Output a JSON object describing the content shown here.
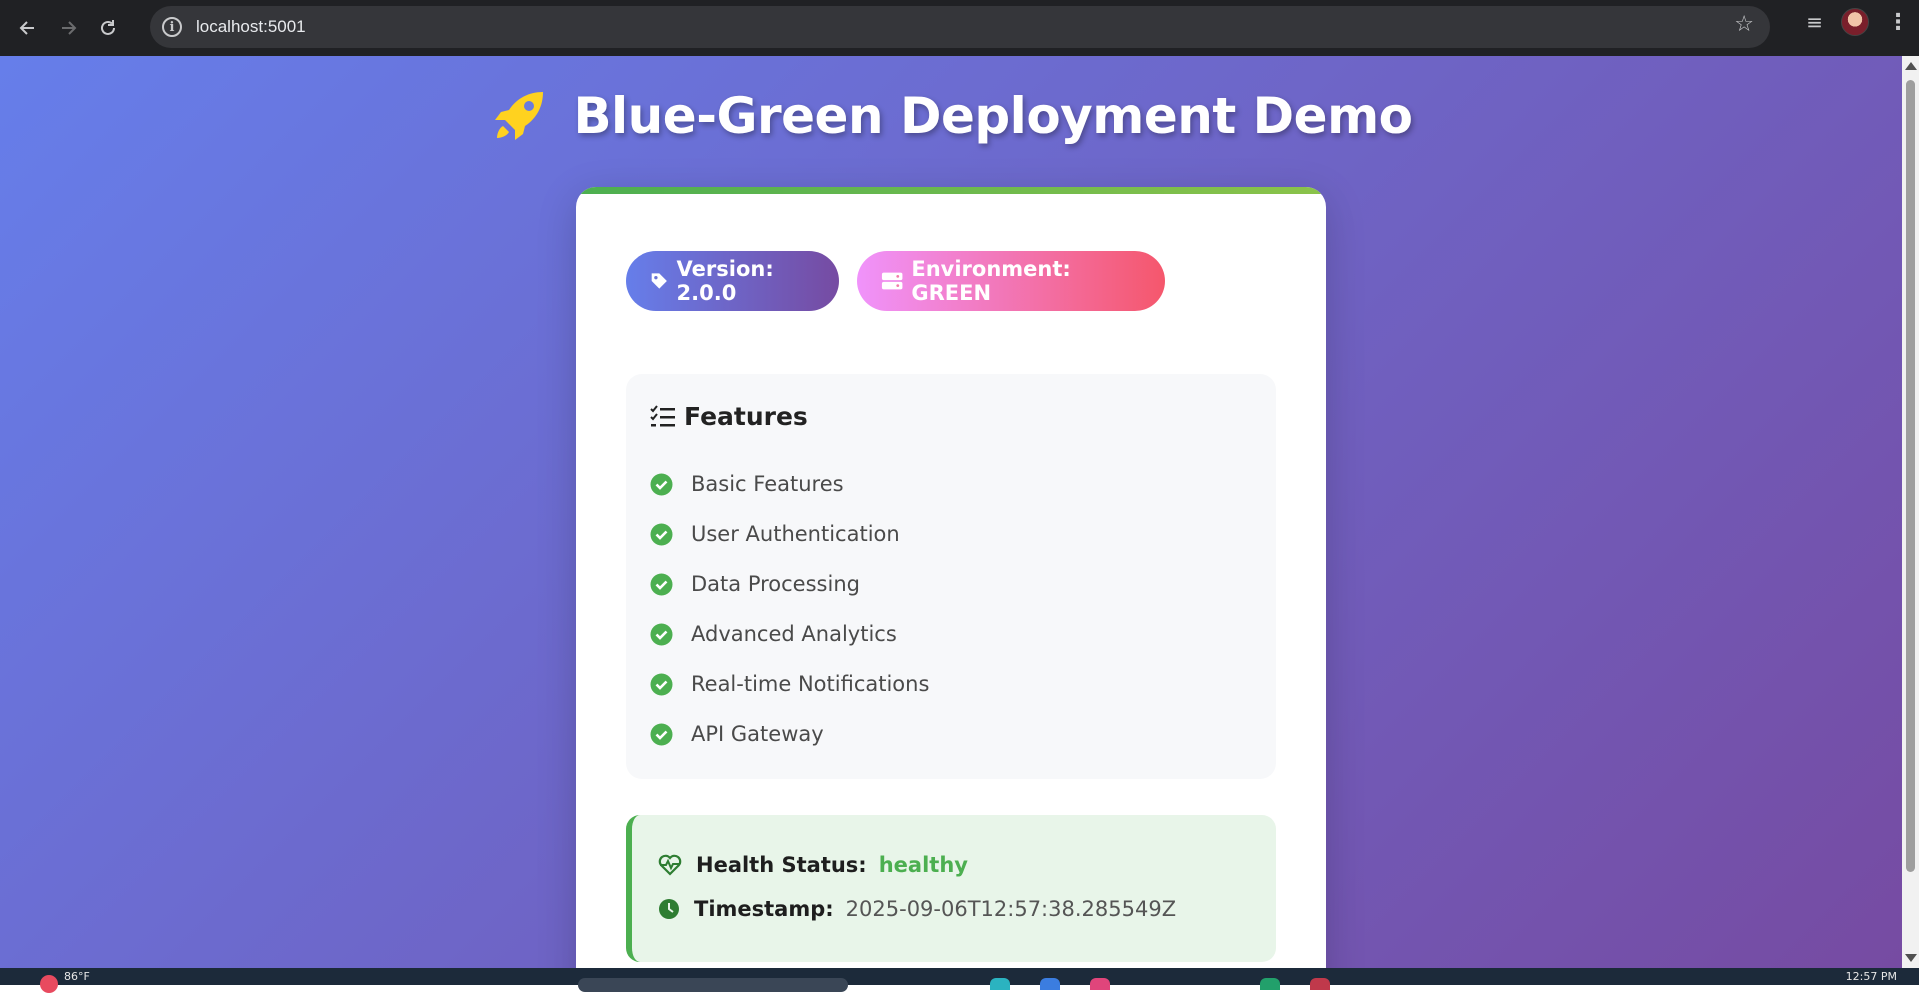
{
  "browser": {
    "url": "localhost:5001"
  },
  "page": {
    "title": "Blue-Green Deployment Demo",
    "version_badge": "Version: 2.0.0",
    "environment_badge": "Environment: GREEN"
  },
  "features": {
    "title": "Features",
    "items": [
      {
        "label": "Basic Features"
      },
      {
        "label": "User Authentication"
      },
      {
        "label": "Data Processing"
      },
      {
        "label": "Advanced Analytics"
      },
      {
        "label": "Real-time Notifications"
      },
      {
        "label": "API Gateway"
      }
    ]
  },
  "health": {
    "status_label": "Health Status:",
    "status_value": "healthy",
    "timestamp_label": "Timestamp:",
    "timestamp_value": "2025-09-06T12:57:38.285549Z"
  },
  "taskbar": {
    "weather": "86°F",
    "clock": "12:57 PM"
  },
  "colors": {
    "background_gradient_start": "#667eea",
    "background_gradient_end": "#764ba2",
    "success_green": "#4caf50",
    "env_badge_start": "#f093fb",
    "env_badge_end": "#f5576c",
    "rocket_yellow": "#ffd21f"
  }
}
